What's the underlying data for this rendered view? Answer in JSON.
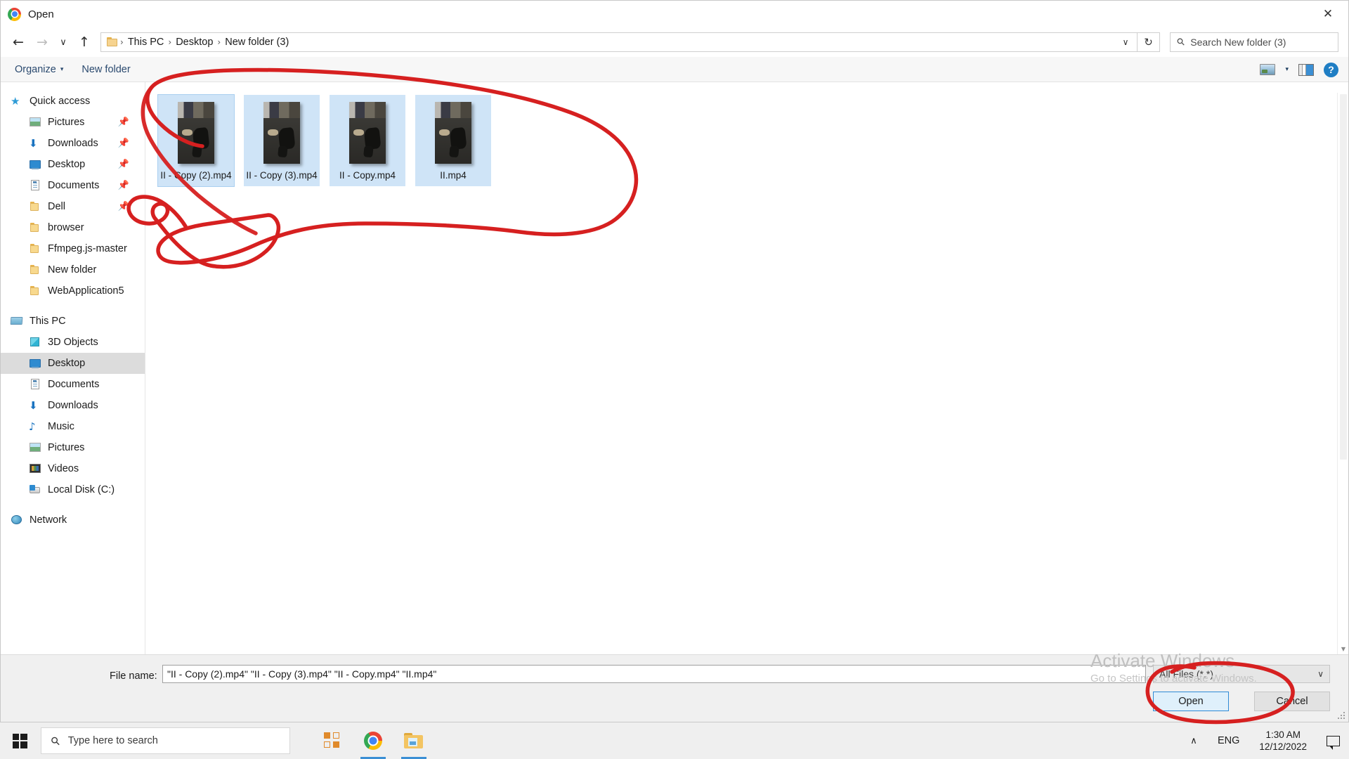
{
  "window": {
    "title": "Open",
    "app_icon": "chrome-logo-icon",
    "close_label": "✕"
  },
  "nav": {
    "back": "←",
    "forward": "→",
    "recent": "∨",
    "up": "↑",
    "address_dropdown": "∨",
    "refresh": "↻",
    "breadcrumb": [
      "This PC",
      "Desktop",
      "New folder (3)"
    ],
    "separator": "›",
    "search_placeholder": "Search New folder (3)",
    "search_icon": "search-icon"
  },
  "command_bar": {
    "organize": "Organize",
    "organize_caret": "▾",
    "new_folder": "New folder",
    "view_icon": "view-layout-icon",
    "view_caret": "▾",
    "preview_pane_icon": "preview-pane-icon",
    "help_label": "?"
  },
  "sidebar": {
    "groups": [
      {
        "header": {
          "label": "Quick access",
          "icon": "star-pin-icon"
        },
        "items": [
          {
            "label": "Pictures",
            "icon": "pictures-icon",
            "pinned": true
          },
          {
            "label": "Downloads",
            "icon": "downloads-icon",
            "pinned": true
          },
          {
            "label": "Desktop",
            "icon": "desktop-icon",
            "pinned": true
          },
          {
            "label": "Documents",
            "icon": "documents-icon",
            "pinned": true
          },
          {
            "label": "Dell",
            "icon": "folder-icon",
            "pinned": true
          },
          {
            "label": "browser",
            "icon": "folder-icon",
            "pinned": false
          },
          {
            "label": "Ffmpeg.js-master",
            "icon": "folder-icon",
            "pinned": false
          },
          {
            "label": "New folder",
            "icon": "folder-icon",
            "pinned": false
          },
          {
            "label": "WebApplication5",
            "icon": "folder-icon",
            "pinned": false
          }
        ]
      },
      {
        "header": {
          "label": "This PC",
          "icon": "this-pc-icon"
        },
        "items": [
          {
            "label": "3D Objects",
            "icon": "3d-objects-icon",
            "pinned": false
          },
          {
            "label": "Desktop",
            "icon": "desktop-icon",
            "pinned": false,
            "selected": true
          },
          {
            "label": "Documents",
            "icon": "documents-icon",
            "pinned": false
          },
          {
            "label": "Downloads",
            "icon": "downloads-icon",
            "pinned": false
          },
          {
            "label": "Music",
            "icon": "music-icon",
            "pinned": false
          },
          {
            "label": "Pictures",
            "icon": "pictures-icon",
            "pinned": false
          },
          {
            "label": "Videos",
            "icon": "videos-icon",
            "pinned": false
          },
          {
            "label": "Local Disk (C:)",
            "icon": "local-disk-icon",
            "pinned": false
          }
        ]
      },
      {
        "header": {
          "label": "Network",
          "icon": "network-icon"
        },
        "items": []
      }
    ]
  },
  "files": [
    {
      "name": "II - Copy (2).mp4",
      "selected": true
    },
    {
      "name": "II - Copy (3).mp4",
      "selected": true
    },
    {
      "name": "II - Copy.mp4",
      "selected": true
    },
    {
      "name": "II.mp4",
      "selected": true
    }
  ],
  "footer": {
    "file_name_label": "File name:",
    "file_name_value": "\"II - Copy (2).mp4\" \"II - Copy (3).mp4\" \"II - Copy.mp4\" \"II.mp4\"",
    "file_type_value": "All Files (*.*)",
    "file_type_caret": "∨",
    "open_label": "Open",
    "cancel_label": "Cancel"
  },
  "watermark": {
    "title": "Activate Windows",
    "subtitle": "Go to Settings to activate Windows."
  },
  "annotation": {
    "color": "#d62020",
    "description": "hand-drawn-red-circle"
  },
  "taskbar": {
    "start_icon": "windows-start-icon",
    "search_placeholder": "Type here to search",
    "search_icon": "search-icon",
    "task_view_icon": "task-view-icon",
    "chrome_icon": "chrome-icon",
    "explorer_icon": "file-explorer-icon",
    "tray_caret": "∧",
    "language": "ENG",
    "time": "1:30 AM",
    "date": "12/12/2022",
    "notification_icon": "notification-icon"
  }
}
